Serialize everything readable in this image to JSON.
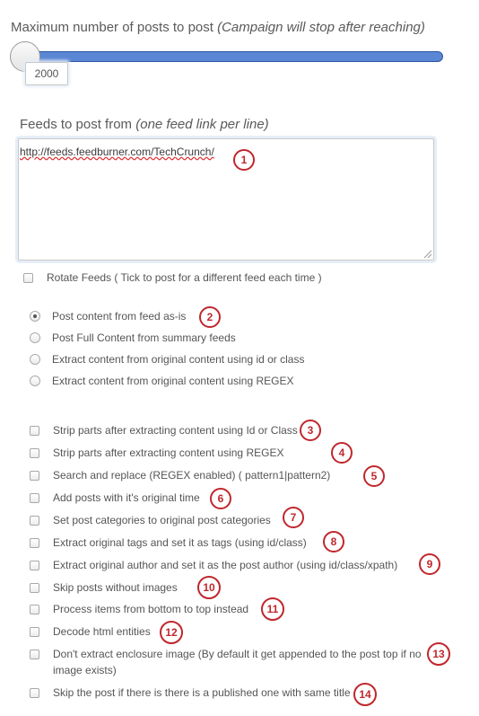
{
  "max_posts": {
    "label": "Maximum number of posts to post",
    "hint": "(Campaign will stop after reaching)",
    "value": "2000",
    "slider_level_percent": 0
  },
  "feeds": {
    "label": "Feeds to post from",
    "hint": "(one feed link per line)",
    "value": "http://feeds.feedburner.com/TechCrunch/"
  },
  "rotate_feeds": {
    "label": "Rotate Feeds ( Tick to post for a different feed each time )",
    "checked": false
  },
  "content_modes": [
    {
      "label": "Post content from feed as-is",
      "selected": true
    },
    {
      "label": "Post Full Content from summary feeds",
      "selected": false
    },
    {
      "label": "Extract content from original content using id or class",
      "selected": false
    },
    {
      "label": "Extract content from original content using REGEX",
      "selected": false
    }
  ],
  "options": [
    {
      "label": "Strip parts after extracting content using Id or Class",
      "checked": false
    },
    {
      "label": "Strip parts after extracting content using REGEX",
      "checked": false
    },
    {
      "label": "Search and replace (REGEX enabled) ( pattern1|pattern2)",
      "checked": false
    },
    {
      "label": "Add posts with it's original time",
      "checked": false
    },
    {
      "label": "Set post categories to original post categories",
      "checked": false
    },
    {
      "label": "Extract original tags and set it as tags (using id/class)",
      "checked": false
    },
    {
      "label": "Extract original author and set it as the post author (using id/class/xpath)",
      "checked": false
    },
    {
      "label": "Skip posts without images",
      "checked": false
    },
    {
      "label": "Process items from bottom to top instead",
      "checked": false
    },
    {
      "label": "Decode html entities",
      "checked": false
    },
    {
      "label": "Don't extract enclosure image (By default it get appended to the post top if no",
      "label_line2": "image exists)",
      "checked": false
    },
    {
      "label": "Skip the post if there is there is a published one with same title",
      "checked": false
    }
  ],
  "annotations": [
    "1",
    "2",
    "3",
    "4",
    "5",
    "6",
    "7",
    "8",
    "9",
    "10",
    "11",
    "12",
    "13",
    "14"
  ],
  "colors": {
    "slider": "#5b86d4",
    "annotation": "#c0272d"
  }
}
